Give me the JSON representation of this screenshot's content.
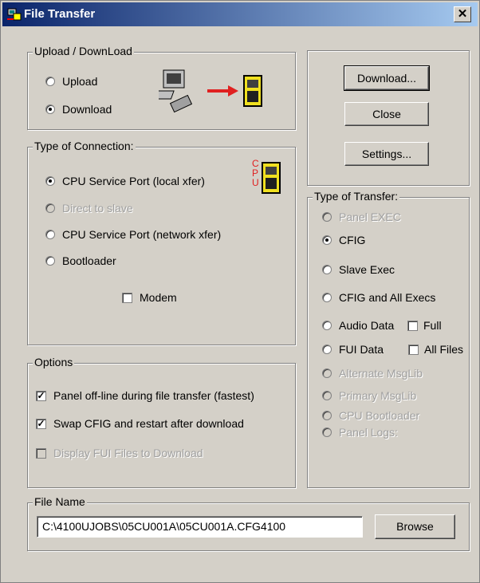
{
  "window": {
    "title": "File Transfer",
    "close_glyph": "✕"
  },
  "upload_download": {
    "legend": "Upload / DownLoad",
    "options": [
      {
        "label": "Upload",
        "selected": false
      },
      {
        "label": "Download",
        "selected": true
      }
    ]
  },
  "connection": {
    "legend": "Type of Connection:",
    "cpu_letters": "C P U",
    "options": [
      {
        "label": "CPU Service Port (local xfer)",
        "selected": true,
        "enabled": true
      },
      {
        "label": "Direct to slave",
        "selected": false,
        "enabled": false
      },
      {
        "label": "CPU Service Port (network xfer)",
        "selected": false,
        "enabled": true
      },
      {
        "label": "Bootloader",
        "selected": false,
        "enabled": true
      }
    ],
    "modem": {
      "label": "Modem",
      "checked": false
    }
  },
  "options": {
    "legend": "Options",
    "items": [
      {
        "label": "Panel off-line during file transfer (fastest)",
        "checked": true,
        "enabled": true
      },
      {
        "label": "Swap CFIG and restart after download",
        "checked": true,
        "enabled": true
      },
      {
        "label": "Display FUI Files to Download",
        "checked": false,
        "enabled": false
      }
    ]
  },
  "buttons": {
    "download": "Download...",
    "close": "Close",
    "settings": "Settings...",
    "browse": "Browse"
  },
  "transfer": {
    "legend": "Type of Transfer:",
    "options": [
      {
        "label": "Panel EXEC",
        "selected": false,
        "enabled": false
      },
      {
        "label": "CFIG",
        "selected": true,
        "enabled": true
      },
      {
        "label": "Slave Exec",
        "selected": false,
        "enabled": true
      },
      {
        "label": "CFIG and All Execs",
        "selected": false,
        "enabled": true
      },
      {
        "label": "Audio Data",
        "selected": false,
        "enabled": true
      },
      {
        "label": "FUI Data",
        "selected": false,
        "enabled": true
      },
      {
        "label": "Alternate MsgLib",
        "selected": false,
        "enabled": false
      },
      {
        "label": "Primary MsgLib",
        "selected": false,
        "enabled": false
      },
      {
        "label": "CPU Bootloader",
        "selected": false,
        "enabled": false
      },
      {
        "label": "Panel Logs:",
        "selected": false,
        "enabled": false
      }
    ],
    "full": {
      "label": "Full",
      "checked": false
    },
    "all_files": {
      "label": "All Files",
      "checked": false
    }
  },
  "file": {
    "legend": "File Name",
    "value": "C:\\4100UJOBS\\05CU001A\\05CU001A.CFG4100"
  },
  "icons": [
    "app-icon",
    "computer-icon",
    "arrow-icon",
    "panel-icon",
    "cpu-panel-icon"
  ],
  "colors": {
    "title_start": "#0a246a",
    "title_end": "#a6caf0",
    "face": "#d4d0c8",
    "arrow": "#e02020",
    "panel": "#f0e020"
  }
}
